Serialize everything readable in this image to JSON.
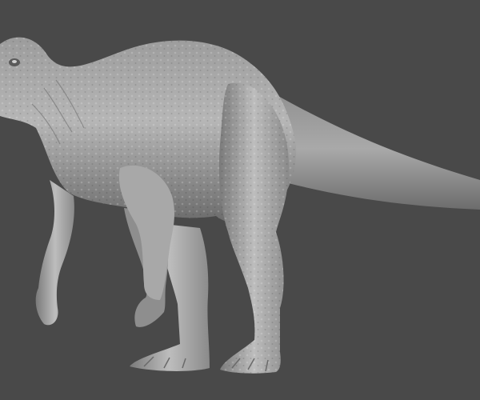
{
  "colors": {
    "background": "#494949",
    "skin_light": "#c4c4c4",
    "skin_mid": "#9a9a9a",
    "skin_dark": "#5e5e5e"
  },
  "icons": []
}
